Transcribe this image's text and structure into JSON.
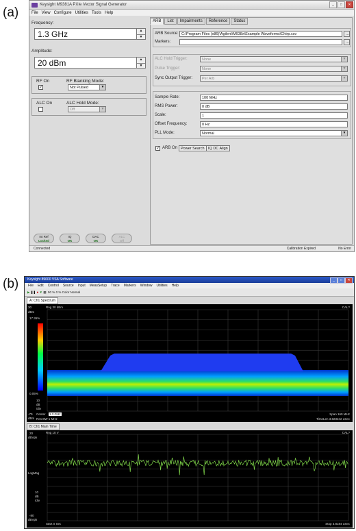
{
  "labels": {
    "a": "(a)",
    "b": "(b)"
  },
  "siggen": {
    "title": "Keysight M9381A PXIe Vector Signal Generator",
    "menu": [
      "File",
      "View",
      "Configure",
      "Utilities",
      "Tools",
      "Help"
    ],
    "frequency": {
      "label": "Frequency:",
      "value": "1.3 GHz"
    },
    "amplitude": {
      "label": "Amplitude:",
      "value": "20 dBm"
    },
    "rf_on": {
      "label": "RF On",
      "checked": true
    },
    "rf_blanking": {
      "label": "RF Blanking Mode:",
      "value": "Not Pulsed"
    },
    "alc_on": {
      "label": "ALC On",
      "checked": false
    },
    "alc_hold": {
      "label": "ALC Hold Mode:",
      "value": "Off"
    },
    "tabs": [
      "ARB",
      "List",
      "Impairments",
      "Reference",
      "Status"
    ],
    "arb_source": {
      "label": "ARB Source:",
      "value": "C:\\Program Files (x86)\\Agilent\\M938x\\Example Waveforms\\Chirp.csv"
    },
    "markers": {
      "label": "Markers:",
      "value": ""
    },
    "alc_hold_trigger": {
      "label": "ALC Hold Trigger:",
      "value": "None"
    },
    "pulse_trigger": {
      "label": "Pulse Trigger:",
      "value": "None"
    },
    "sync_output_trigger": {
      "label": "Sync Output Trigger:",
      "value": "Per Arb"
    },
    "sample_rate": {
      "label": "Sample Rate:",
      "value": "100 MHz"
    },
    "rms_power": {
      "label": "RMS Power:",
      "value": "0 dB"
    },
    "scale": {
      "label": "Scale:",
      "value": "1"
    },
    "offset_frequency": {
      "label": "Offset Frequency:",
      "value": "0 Hz"
    },
    "pll_mode": {
      "label": "PLL Mode:",
      "value": "Normal"
    },
    "arb_on": {
      "label": "ARB On",
      "checked": true
    },
    "power_search_label": "Power Search",
    "iq_dc_align_label": "IQ DC Align",
    "status_buttons": [
      {
        "top": "Int Ref",
        "bottom": "Locked"
      },
      {
        "top": "IQ",
        "bottom": "OK"
      },
      {
        "top": "DAC",
        "bottom": "OK"
      },
      {
        "top": "ALC",
        "bottom": "Off"
      }
    ],
    "status": {
      "connected": "Connected",
      "calibration": "Calibration Expired",
      "error": "No Error"
    }
  },
  "vsa": {
    "title": "Keysight 89600 VSA Software",
    "menu": [
      "File",
      "Edit",
      "Control",
      "Source",
      "Input",
      "MeasSetup",
      "Trace",
      "Markers",
      "Window",
      "Utilities",
      "Help"
    ],
    "toolbar": {
      "zoom1": "50 %",
      "zoom2": "0 %",
      "color": "Color Normal"
    },
    "spectrum": {
      "tab": "A: Ch1 Spectrum",
      "ref": "Rng 30 dBm",
      "cal": "CAL?",
      "scale_top": "30",
      "scale_unit": "dBm",
      "pct_top": "17.36%",
      "pct_bottom": "0.05%",
      "div": "10",
      "div_unit1": "dB",
      "div_unit2": "/div",
      "bottom_val": "-70",
      "bottom_unit": "dBm",
      "center_label": "Center",
      "center": "1.3 GHz",
      "res_bw": "Res BW 1 MHz",
      "span": "Span 160 MHz",
      "timelen": "TimeLen 3.823242 uSec"
    },
    "maintime": {
      "tab": "B: Ch1 Main Time",
      "ref": "Rng 10  V",
      "cal": "CAL?",
      "top": "20",
      "top_unit": "dBVpk",
      "logmag": "LogMag",
      "div": "10",
      "div_unit1": "dB",
      "div_unit2": "/div",
      "bottom": "-80",
      "bottom_unit": "dBVpk",
      "start": "Start 0  Sec",
      "stop": "Stop 3.8184 uSec"
    },
    "colors": {
      "density_top": "#ff0000",
      "density_bottom": "#0000ff",
      "trace": "#7fd64a"
    }
  }
}
